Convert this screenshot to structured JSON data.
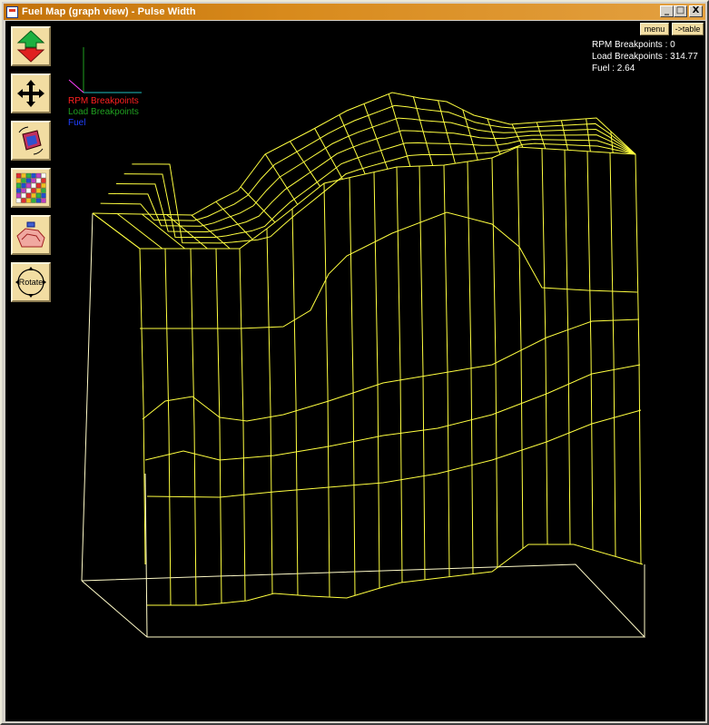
{
  "window": {
    "title": "Fuel Map (graph view) - Pulse Width",
    "minimize_glyph": "_",
    "maximize_glyph": "□",
    "close_glyph": "X"
  },
  "toolbar": {
    "menu_label": "menu",
    "table_label": "->table",
    "rotate_label": "Rotate"
  },
  "readout": {
    "rpm": "RPM Breakpoints : 0",
    "load": "Load Breakpoints : 314.77",
    "fuel": "Fuel : 2.64"
  },
  "legend": {
    "rpm": "RPM Breakpoints",
    "load": "Load Breakpoints",
    "fuel": "Fuel"
  },
  "colors": {
    "mesh": "#ffff40",
    "bounding_box": "#fffbc8",
    "rpm_axis": "#ff2020",
    "load_axis": "#20a020",
    "fuel_axis": "#2040ff",
    "button_face": "#f2dda2"
  },
  "icons": [
    "up-down-arrows-icon",
    "move-cross-icon",
    "rotate-view-icon",
    "color-grid-icon",
    "surface-view-icon",
    "rotate-icon"
  ]
}
